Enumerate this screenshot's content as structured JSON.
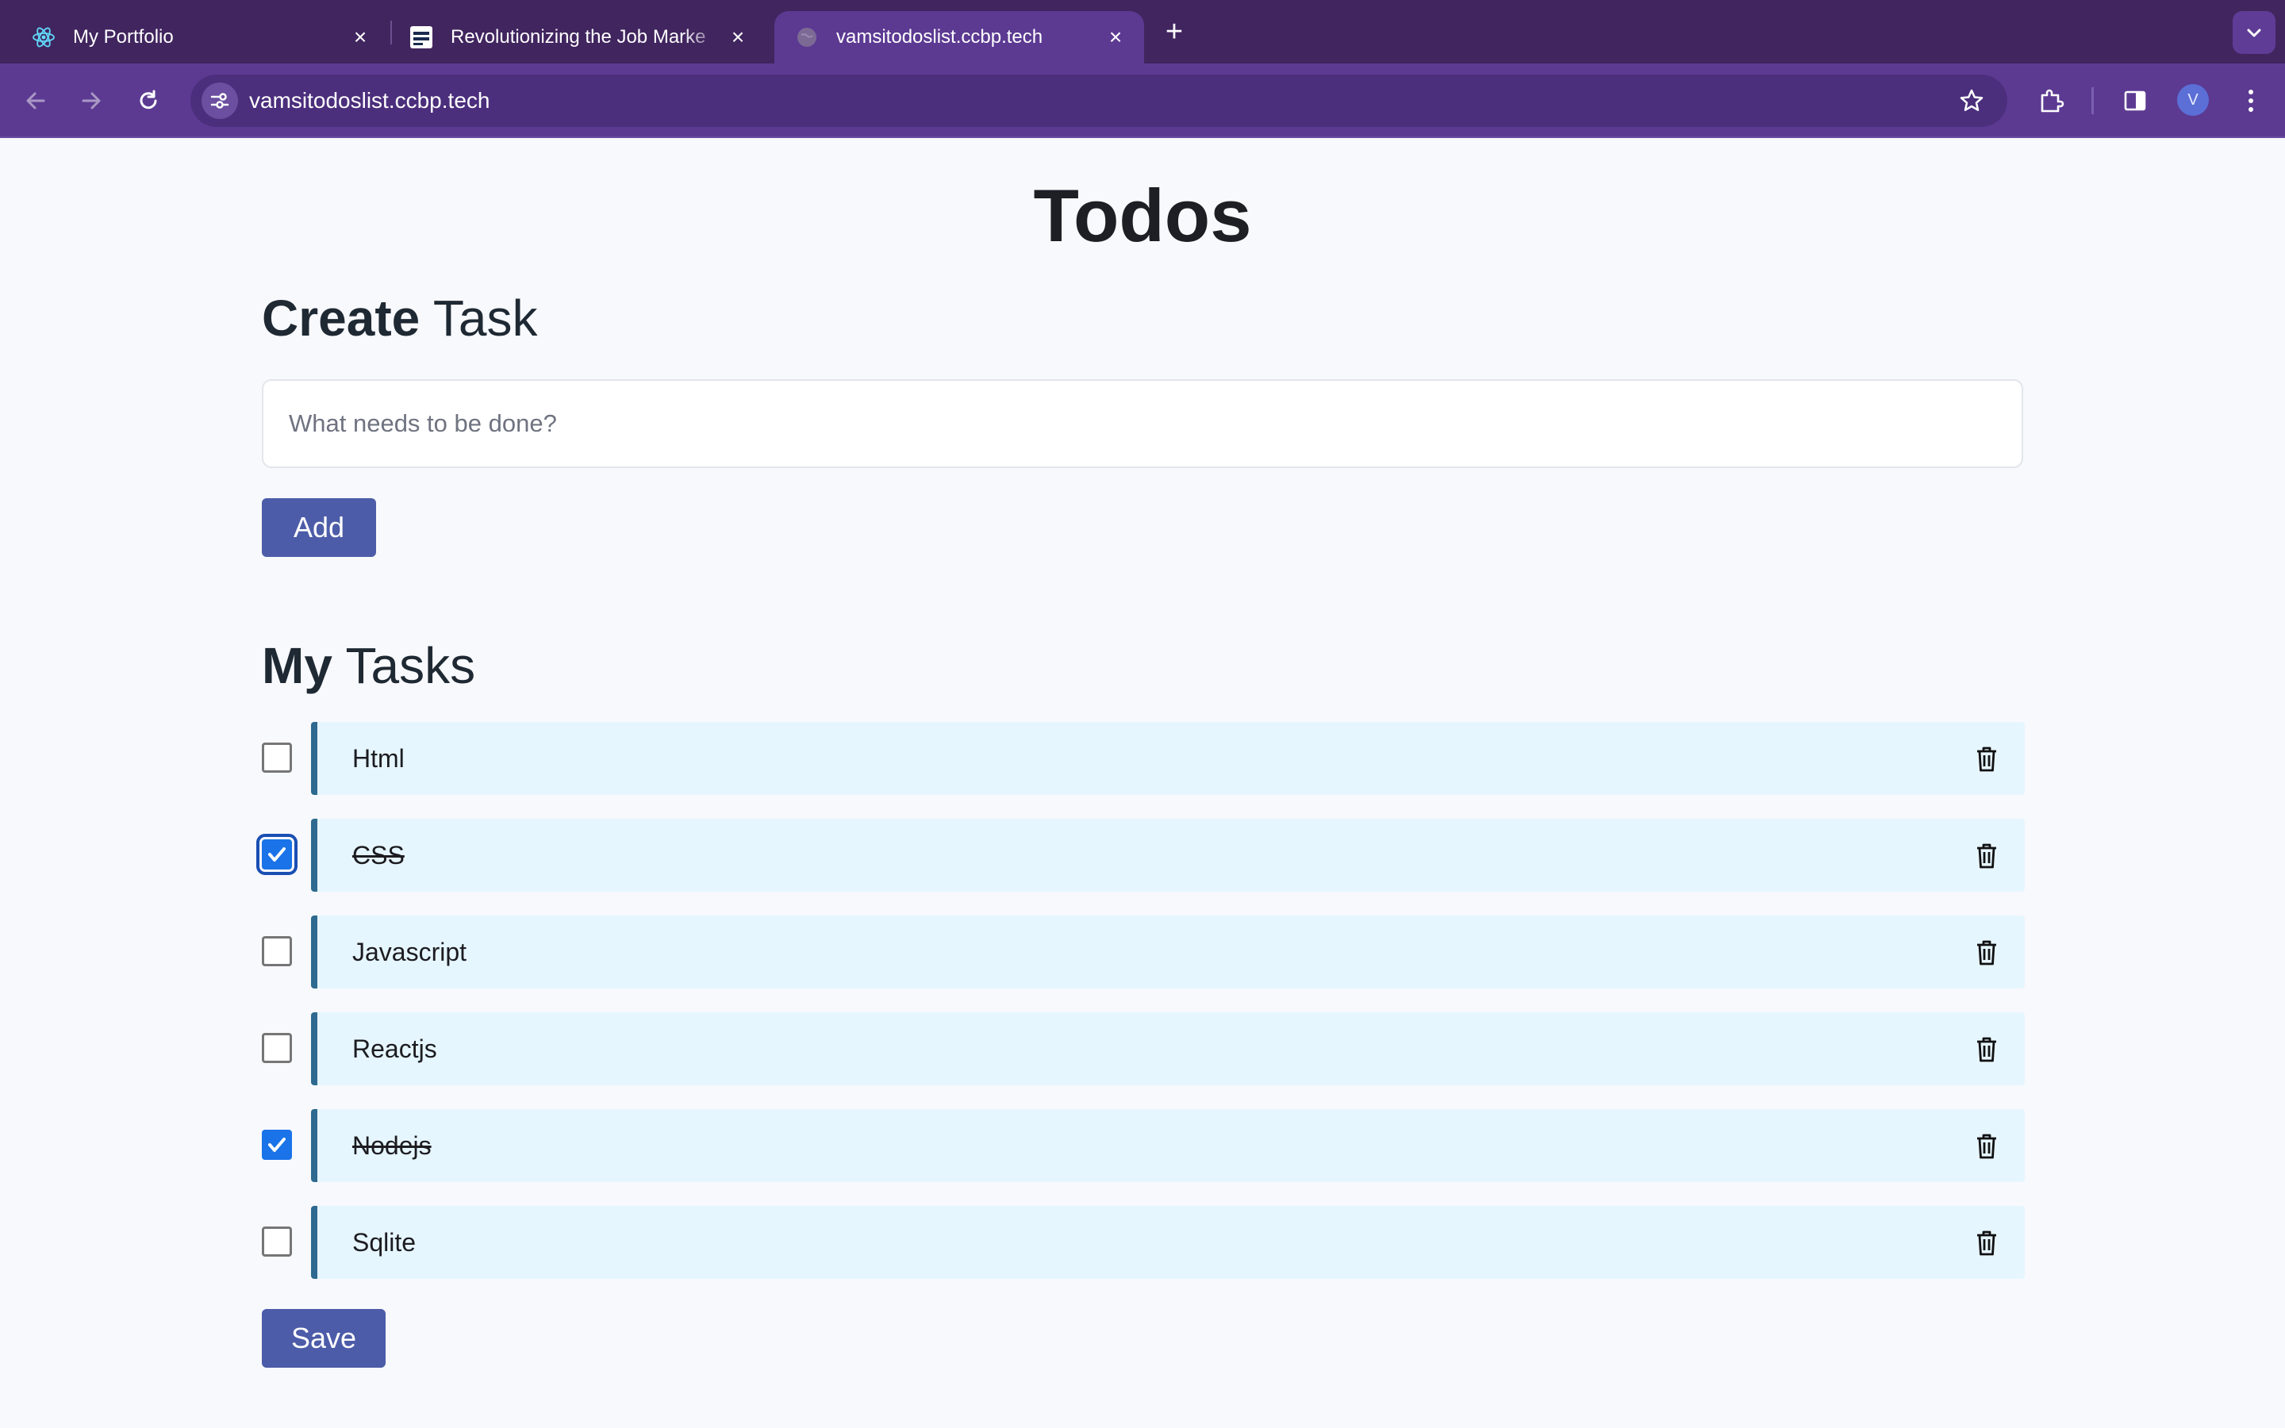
{
  "browser": {
    "tabs": [
      {
        "title": "My Portfolio",
        "active": false,
        "favicon": "react-icon"
      },
      {
        "title": "Revolutionizing the Job Marke",
        "active": false,
        "favicon": "nxtwave-icon"
      },
      {
        "title": "vamsitodoslist.ccbp.tech",
        "active": true,
        "favicon": "globe-icon"
      }
    ],
    "url": "vamsitodoslist.ccbp.tech",
    "avatar_letter": "V",
    "colors": {
      "tabstrip": "#41255f",
      "toolbar": "#5c3a92"
    }
  },
  "page": {
    "title": "Todos",
    "create": {
      "bold": "Create",
      "light": " Task"
    },
    "input_placeholder": "What needs to be done?",
    "add_label": "Add",
    "tasks_heading": {
      "bold": "My",
      "light": " Tasks"
    },
    "tasks": [
      {
        "label": "Html",
        "checked": false
      },
      {
        "label": "CSS",
        "checked": true
      },
      {
        "label": "Javascript",
        "checked": false
      },
      {
        "label": "Reactjs",
        "checked": false
      },
      {
        "label": "Nodejs",
        "checked": true
      },
      {
        "label": "Sqlite",
        "checked": false
      }
    ],
    "save_label": "Save",
    "colors": {
      "button": "#4c5ca8",
      "card": "#e6f6ff",
      "card_border": "#2e6a8f",
      "checkbox": "#1a73e8"
    }
  }
}
